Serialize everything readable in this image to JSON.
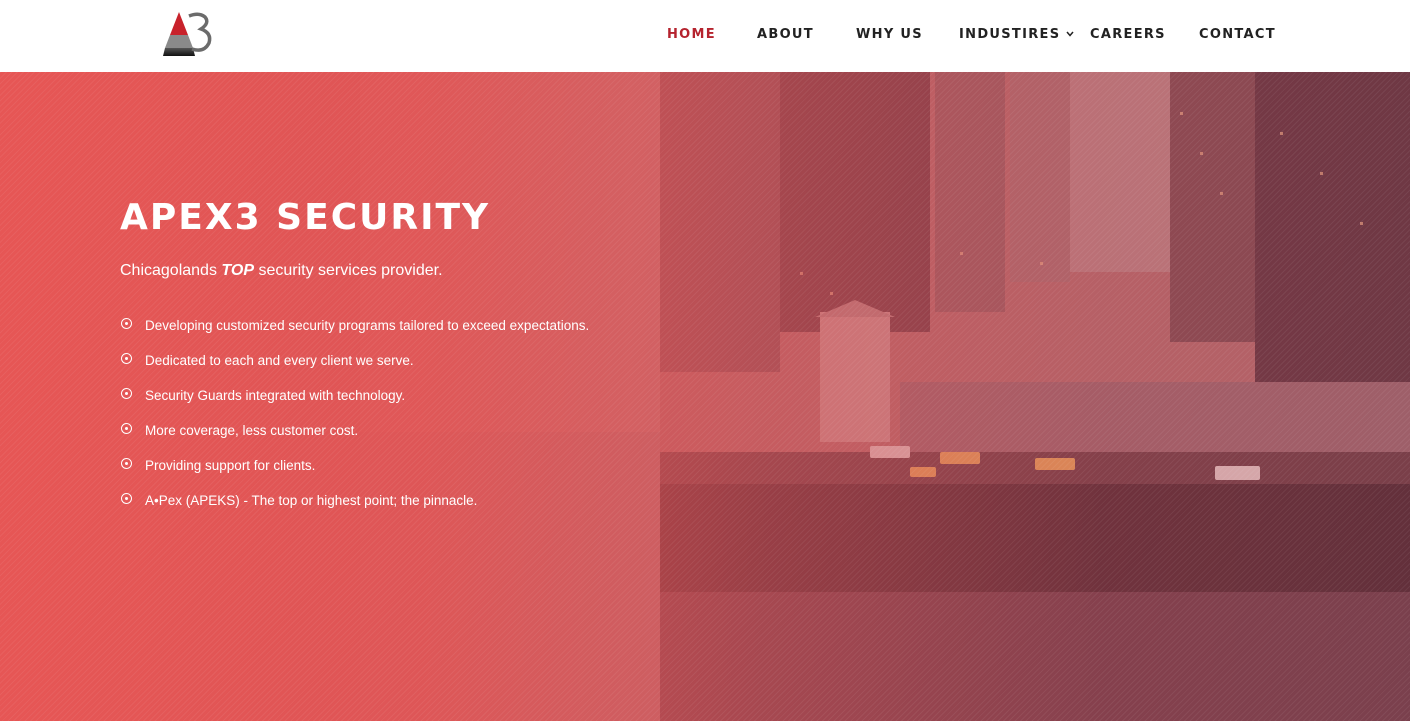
{
  "header": {
    "logo_name": "apex3-logo",
    "nav": [
      {
        "label": "HOME",
        "active": true
      },
      {
        "label": "ABOUT"
      },
      {
        "label": "WHY US"
      },
      {
        "label": "INDUSTIRES",
        "has_dropdown": true
      },
      {
        "label": "CAREERS"
      },
      {
        "label": "CONTACT"
      }
    ]
  },
  "hero": {
    "title": "APEX3 SECURITY",
    "tagline_before": "Chicagolands ",
    "tagline_emphasis": "TOP",
    "tagline_after": " security services provider.",
    "features": [
      "Developing customized security programs tailored to exceed expectations.",
      "Dedicated to each and every client we serve.",
      "Security Guards integrated with technology.",
      "More coverage, less customer cost.",
      "Providing support for clients.",
      "A•Pex (APEKS) - The top or highest point; the pinnacle."
    ]
  },
  "colors": {
    "accent": "#b5232e",
    "overlay": "#e85554",
    "nav_text": "#222222"
  }
}
